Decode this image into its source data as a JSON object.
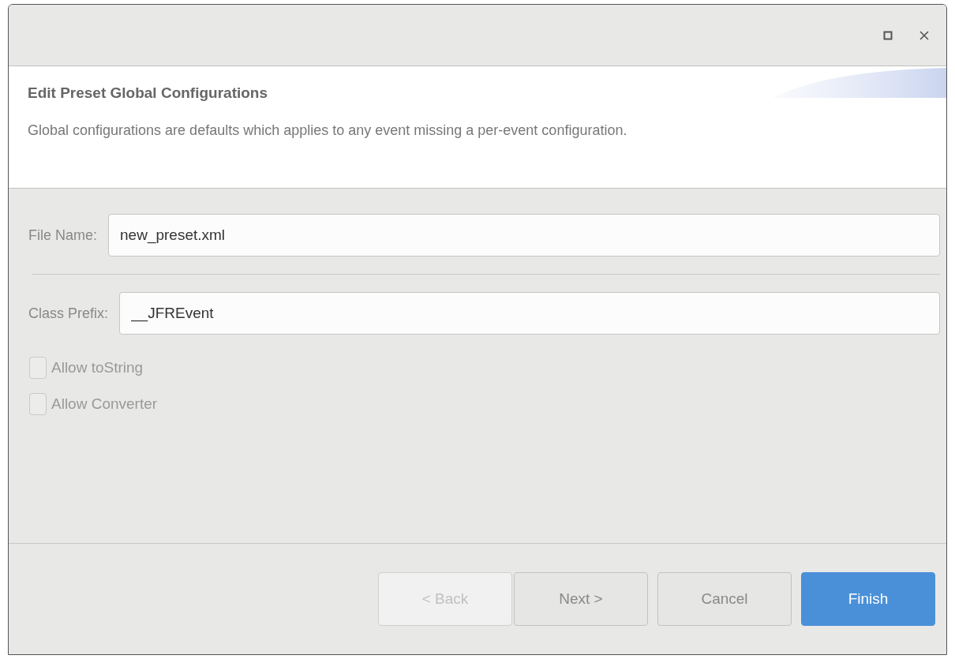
{
  "header": {
    "title": "Edit Preset Global Configurations",
    "description": "Global configurations are defaults which applies to any event missing a per-event configuration."
  },
  "fields": [
    {
      "label": "File Name:",
      "value": "new_preset.xml"
    },
    {
      "label": "Class Prefix:",
      "value": "__JFREvent"
    }
  ],
  "checkboxes": [
    {
      "label": "Allow toString",
      "checked": false
    },
    {
      "label": "Allow Converter",
      "checked": false
    }
  ],
  "buttons": [
    {
      "label": "< Back",
      "kind": "default",
      "disabled": true
    },
    {
      "label": "Next >",
      "kind": "default",
      "disabled": false
    },
    {
      "label": "Cancel",
      "kind": "default",
      "disabled": false
    },
    {
      "label": "Finish",
      "kind": "primary",
      "disabled": false
    }
  ]
}
